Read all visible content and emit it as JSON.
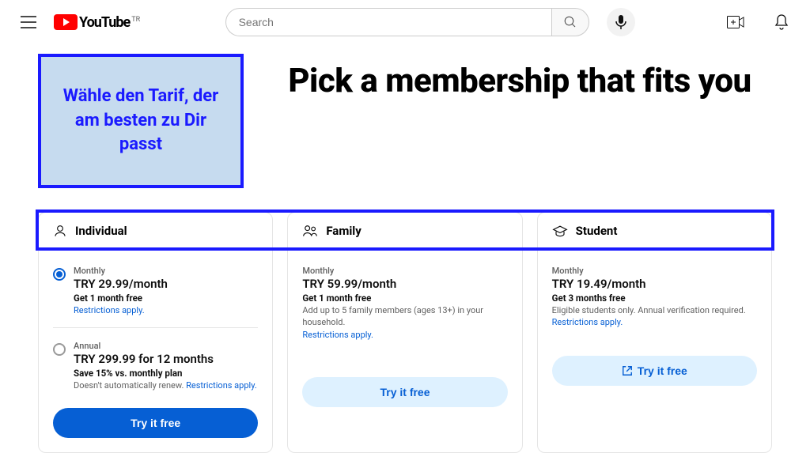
{
  "header": {
    "logo_text": "YouTube",
    "logo_region": "TR",
    "search_placeholder": "Search"
  },
  "annotation": "Wähle den Tarif, der am besten zu Dir passt",
  "title": "Pick a membership that fits you",
  "restrictions_link": "Restrictions apply.",
  "plans": [
    {
      "name": "Individual",
      "options": [
        {
          "billing": "Monthly",
          "price": "TRY 29.99/month",
          "promo": "Get 1 month free",
          "desc": "",
          "selected": true
        },
        {
          "billing": "Annual",
          "price": "TRY 299.99 for 12 months",
          "promo": "Save 15% vs. monthly plan",
          "desc": "Doesn't automatically renew.",
          "selected": false
        }
      ],
      "cta": "Try it free",
      "cta_style": "primary"
    },
    {
      "name": "Family",
      "options": [
        {
          "billing": "Monthly",
          "price": "TRY 59.99/month",
          "promo": "Get 1 month free",
          "desc": "Add up to 5 family members (ages 13+) in your household."
        }
      ],
      "cta": "Try it free",
      "cta_style": "secondary"
    },
    {
      "name": "Student",
      "options": [
        {
          "billing": "Monthly",
          "price": "TRY 19.49/month",
          "promo": "Get 3 months free",
          "desc": "Eligible students only. Annual verification required."
        }
      ],
      "cta": "Try it free",
      "cta_style": "secondary",
      "external": true
    }
  ]
}
